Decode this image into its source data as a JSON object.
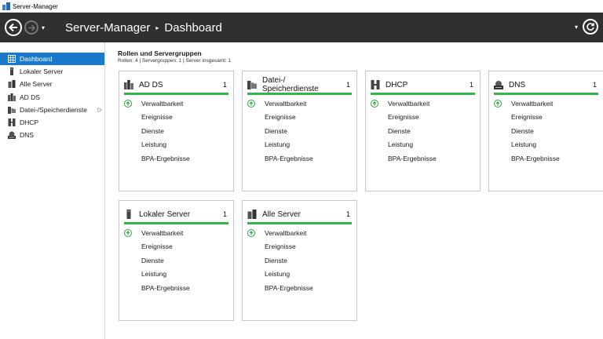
{
  "window": {
    "title": "Server-Manager"
  },
  "header": {
    "app_name": "Server-Manager",
    "separator": "▸",
    "page": "Dashboard",
    "dropdown_glyph": "▾"
  },
  "sidebar": {
    "items": [
      {
        "label": "Dashboard",
        "icon": "dashboard-icon",
        "active": true
      },
      {
        "label": "Lokaler Server",
        "icon": "server-icon"
      },
      {
        "label": "Alle Server",
        "icon": "servers-icon"
      },
      {
        "label": "AD DS",
        "icon": "ad-ds-icon"
      },
      {
        "label": "Datei-/Speicherdienste",
        "icon": "file-storage-icon",
        "submenu": "▷"
      },
      {
        "label": "DHCP",
        "icon": "dhcp-icon"
      },
      {
        "label": "DNS",
        "icon": "dns-icon"
      }
    ]
  },
  "main": {
    "section_title": "Rollen und Servergruppen",
    "section_subtitle": "Rollen: 4   |   Servergruppen: 1   |   Server insgesamt: 1",
    "tiles": [
      {
        "name": "AD DS",
        "count": "1",
        "icon": "ad-ds-icon",
        "rows": [
          "Verwaltbarkeit",
          "Ereignisse",
          "Dienste",
          "Leistung",
          "BPA-Ergebnisse"
        ]
      },
      {
        "name": "Datei-/\nSpeicherdienste",
        "count": "1",
        "icon": "file-storage-icon",
        "rows": [
          "Verwaltbarkeit",
          "Ereignisse",
          "Dienste",
          "Leistung",
          "BPA-Ergebnisse"
        ]
      },
      {
        "name": "DHCP",
        "count": "1",
        "icon": "dhcp-icon",
        "rows": [
          "Verwaltbarkeit",
          "Ereignisse",
          "Dienste",
          "Leistung",
          "BPA-Ergebnisse"
        ]
      },
      {
        "name": "DNS",
        "count": "1",
        "icon": "dns-icon",
        "rows": [
          "Verwaltbarkeit",
          "Ereignisse",
          "Dienste",
          "Leistung",
          "BPA-Ergebnisse"
        ]
      },
      {
        "name": "Lokaler Server",
        "count": "1",
        "icon": "server-icon",
        "rows": [
          "Verwaltbarkeit",
          "Ereignisse",
          "Dienste",
          "Leistung",
          "BPA-Ergebnisse"
        ]
      },
      {
        "name": "Alle Server",
        "count": "1",
        "icon": "servers-icon",
        "rows": [
          "Verwaltbarkeit",
          "Ereignisse",
          "Dienste",
          "Leistung",
          "BPA-Ergebnisse"
        ]
      }
    ]
  },
  "colors": {
    "header_bg": "#303030",
    "active_nav": "#1979ca",
    "status_ok": "#36b34a"
  }
}
